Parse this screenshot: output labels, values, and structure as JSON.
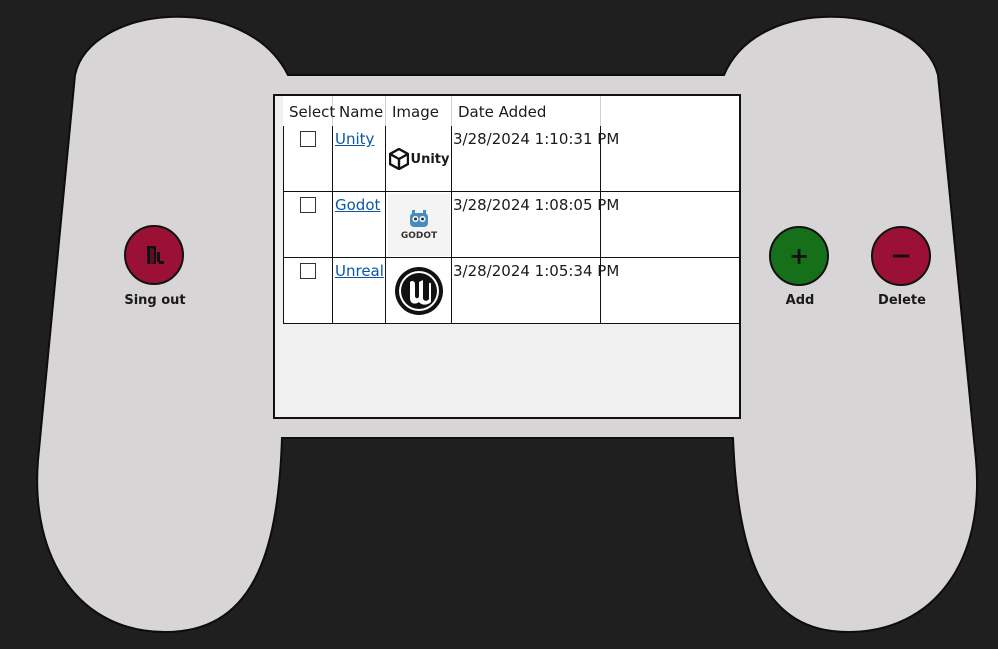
{
  "buttons": {
    "signout_label": "Sing out",
    "add_label": "Add",
    "delete_label": "Delete",
    "add_glyph": "+",
    "delete_glyph": "−"
  },
  "grid": {
    "columns": [
      "Select",
      "Name",
      "Image",
      "Date Added"
    ],
    "rows": [
      {
        "name": "Unity",
        "date": "3/28/2024 1:10:31 PM",
        "image": "unity-logo",
        "logo_text": "Unity",
        "selected": false
      },
      {
        "name": "Godot",
        "date": "3/28/2024 1:08:05 PM",
        "image": "godot-logo",
        "logo_text": "GODOT",
        "selected": false
      },
      {
        "name": "Unreal",
        "date": "3/28/2024 1:05:34 PM",
        "image": "unreal-logo",
        "logo_text": "",
        "selected": false
      }
    ]
  },
  "colors": {
    "background": "#1f1f1f",
    "gamepad_body": "#d8d5d6",
    "signout_button": "#9b1035",
    "add_button": "#16701a",
    "delete_button": "#9b1035",
    "link": "#0b57a4"
  },
  "icons": {
    "signout": "door-exit-icon",
    "add": "plus-icon",
    "delete": "minus-icon"
  }
}
